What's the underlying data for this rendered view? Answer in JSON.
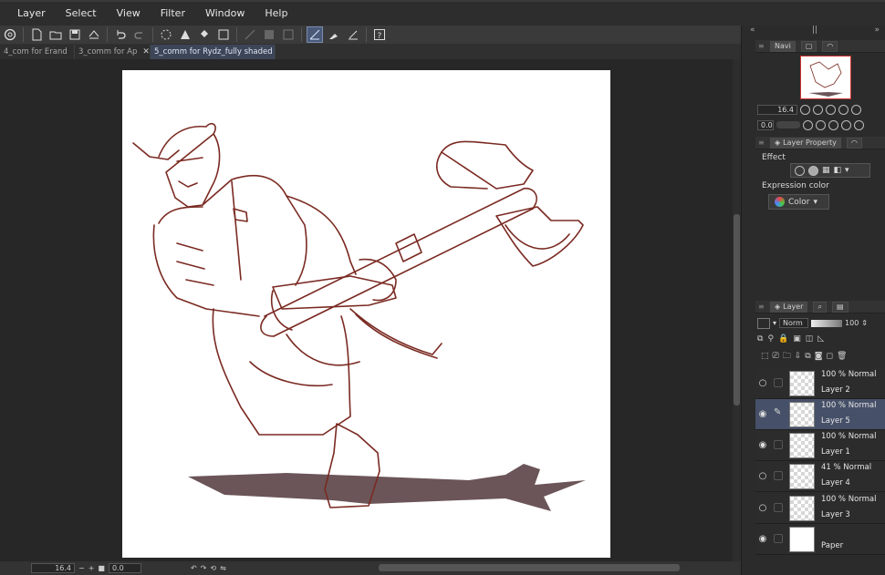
{
  "menu": [
    "Layer",
    "Select",
    "View",
    "Filter",
    "Window",
    "Help"
  ],
  "tabs": [
    {
      "label": "4_com for Erand",
      "active": false
    },
    {
      "label": "3_comm for Ap",
      "active": false
    },
    {
      "label": "5_comm for Rydz_fully shaded",
      "active": true
    }
  ],
  "navigator": {
    "tab_label": "Navi",
    "zoom": "16.4",
    "rotation": "0.0"
  },
  "layer_property": {
    "tab_label": "Layer Property",
    "effect_label": "Effect",
    "expression_color_label": "Expression color",
    "expression_color_value": "Color"
  },
  "layer_panel": {
    "tab_label": "Layer",
    "blend_mode": "Norm",
    "opacity": "100"
  },
  "layers": [
    {
      "mode": "100 % Normal",
      "name": "Layer 2",
      "visible": false,
      "selected": false
    },
    {
      "mode": "100 % Normal",
      "name": "Layer 5",
      "visible": true,
      "selected": true
    },
    {
      "mode": "100 % Normal",
      "name": "Layer 1",
      "visible": true,
      "selected": false
    },
    {
      "mode": "41 % Normal",
      "name": "Layer 4",
      "visible": false,
      "selected": false
    },
    {
      "mode": "100 % Normal",
      "name": "Layer 3",
      "visible": false,
      "selected": false
    },
    {
      "mode": "",
      "name": "Paper",
      "visible": true,
      "selected": false
    }
  ],
  "status": {
    "zoom": "16.4",
    "rotation": "0.0"
  },
  "colors": {
    "line_art": "#7a2a22",
    "shadow": "#6b5558",
    "accent": "#465068"
  }
}
